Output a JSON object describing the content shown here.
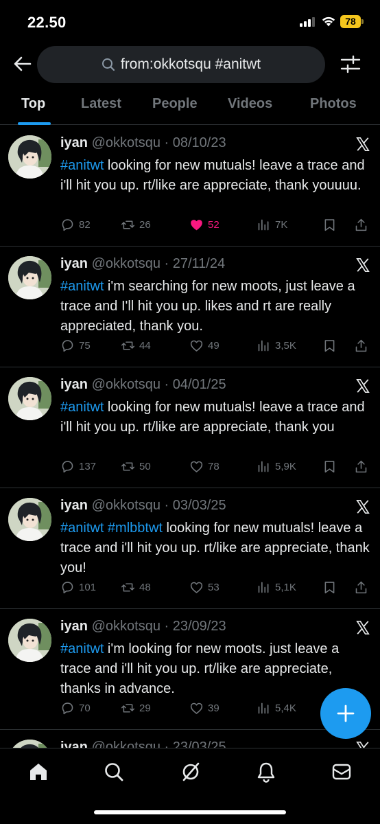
{
  "status_bar": {
    "time": "22.50",
    "battery": "78"
  },
  "search": {
    "query": "from:okkotsqu #anitwt"
  },
  "tabs": [
    {
      "label": "Top",
      "active": true
    },
    {
      "label": "Latest",
      "active": false
    },
    {
      "label": "People",
      "active": false
    },
    {
      "label": "Videos",
      "active": false
    },
    {
      "label": "Photos",
      "active": false
    }
  ],
  "tweets": [
    {
      "name": "iyan",
      "handle": "@okkotsqu",
      "date": "· 08/10/23",
      "hashtags": "#anitwt",
      "text": " looking for new mutuals! leave a trace and i'll hit you up. rt/like are appreciate, thank youuuu.",
      "replies": "82",
      "retweets": "26",
      "likes": "52",
      "views": "7K",
      "liked": true
    },
    {
      "name": "iyan",
      "handle": "@okkotsqu",
      "date": "· 27/11/24",
      "hashtags": "#anitwt",
      "text": " i'm searching for new moots, just leave a trace and I'll hit you up. likes and rt are really appreciated, thank you.",
      "replies": "75",
      "retweets": "44",
      "likes": "49",
      "views": "3,5K",
      "liked": false
    },
    {
      "name": "iyan",
      "handle": "@okkotsqu",
      "date": "· 04/01/25",
      "hashtags": "#anitwt",
      "text": " looking for new mutuals! leave a trace and i'll hit you up. rt/like are appreciate, thank you",
      "replies": "137",
      "retweets": "50",
      "likes": "78",
      "views": "5,9K",
      "liked": false
    },
    {
      "name": "iyan",
      "handle": "@okkotsqu",
      "date": "· 03/03/25",
      "hashtags": "#anitwt #mlbbtwt",
      "text": " looking for new mutuals! leave a trace and i'll hit you up. rt/like are appreciate, thank you!",
      "replies": "101",
      "retweets": "48",
      "likes": "53",
      "views": "5,1K",
      "liked": false
    },
    {
      "name": "iyan",
      "handle": "@okkotsqu",
      "date": "· 23/09/23",
      "hashtags": "#anitwt",
      "text": " i'm looking for new moots. just leave a trace and i'll hit you up. rt/like are appreciate, thanks in advance.",
      "replies": "70",
      "retweets": "29",
      "likes": "39",
      "views": "5,4K",
      "liked": false
    }
  ],
  "partial_tweet": {
    "name": "iyan",
    "handle": "@okkotsqu",
    "date": "· 23/03/25"
  },
  "colors": {
    "accent": "#1d9bf0",
    "like": "#f91880",
    "muted": "#71767b"
  },
  "icons": {
    "top_bar": [
      "back-arrow-icon",
      "search-icon",
      "filter-icon"
    ],
    "bottom_nav": [
      "home-icon",
      "search-icon",
      "grok-icon",
      "notifications-icon",
      "messages-icon"
    ],
    "fab": "plus-icon"
  }
}
